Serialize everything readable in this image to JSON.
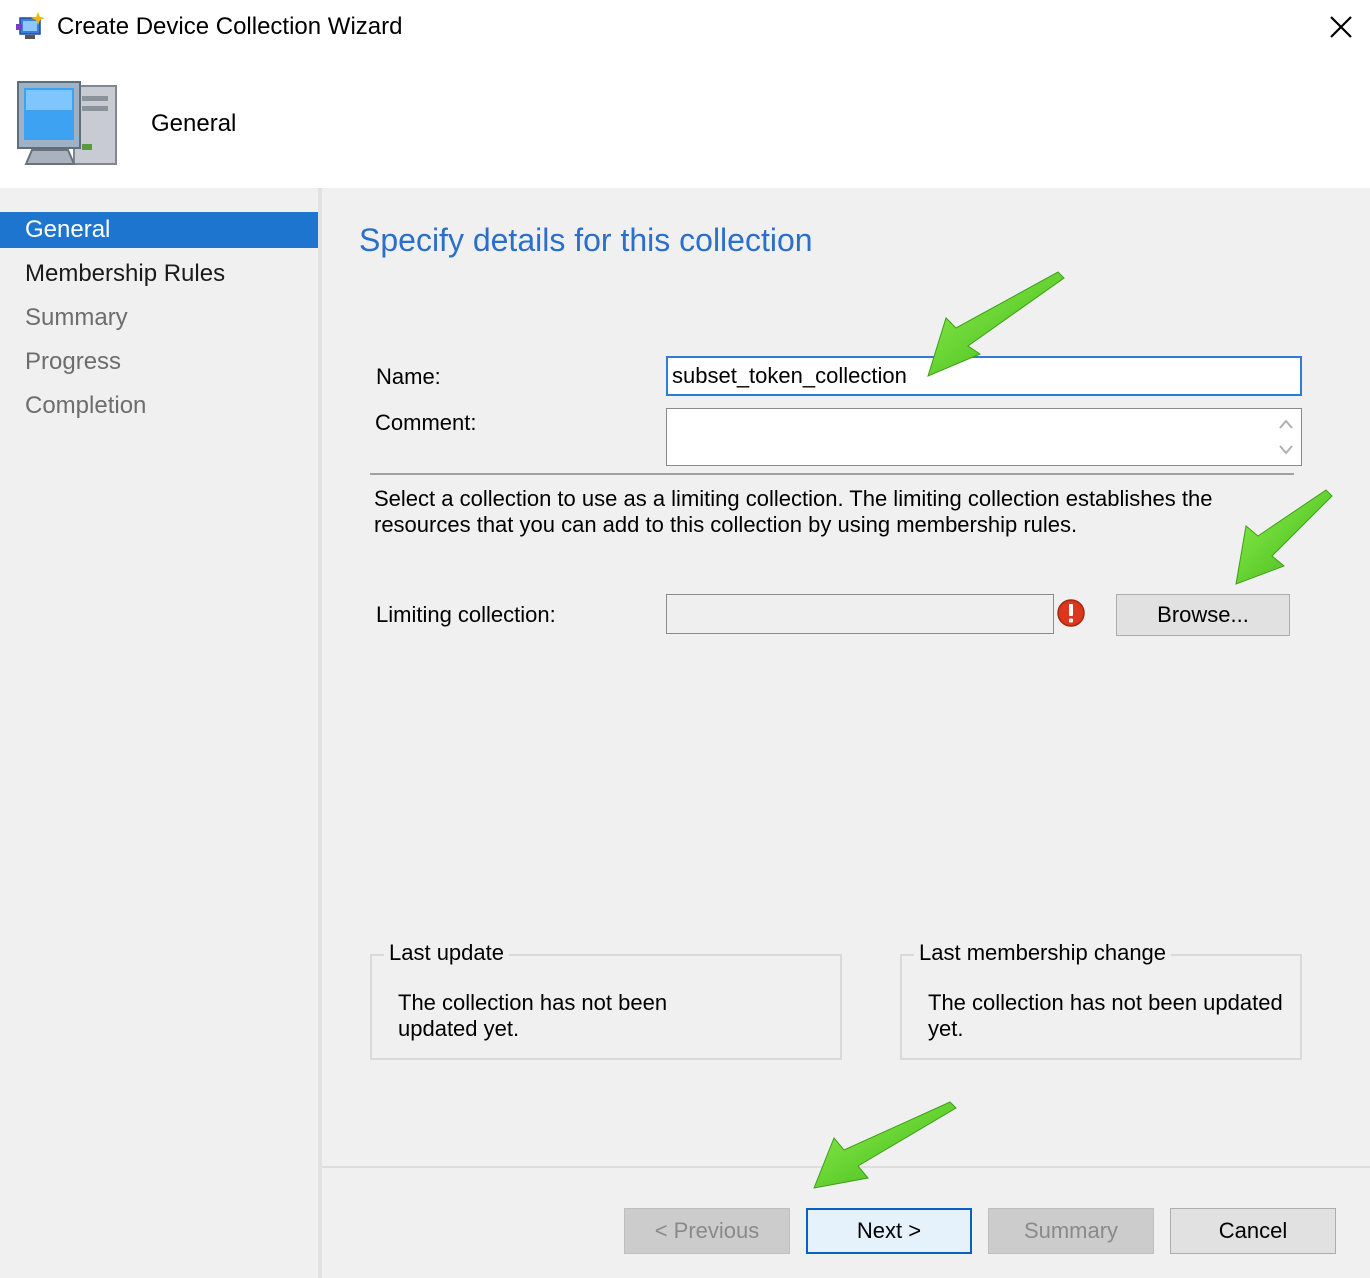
{
  "window": {
    "title": "Create Device Collection Wizard"
  },
  "header": {
    "title": "General"
  },
  "sidebar": {
    "items": [
      {
        "label": "General",
        "state": "active"
      },
      {
        "label": "Membership Rules",
        "state": "next"
      },
      {
        "label": "Summary",
        "state": "pending"
      },
      {
        "label": "Progress",
        "state": "pending"
      },
      {
        "label": "Completion",
        "state": "pending"
      }
    ]
  },
  "page": {
    "title": "Specify details for this collection",
    "name_label": "Name:",
    "name_value": "subset_token_collection",
    "comment_label": "Comment:",
    "comment_value": "",
    "description": "Select a collection to use as a limiting collection. The limiting collection establishes the resources that you can add to this collection by using membership rules.",
    "limiting_label": "Limiting collection:",
    "limiting_value": "",
    "browse_label": "Browse...",
    "last_update": {
      "legend": "Last update",
      "text": "The collection has not been updated yet."
    },
    "last_membership": {
      "legend": "Last membership change",
      "text": "The collection has not been updated yet."
    }
  },
  "footer": {
    "previous_label": "< Previous",
    "next_label": "Next >",
    "summary_label": "Summary",
    "cancel_label": "Cancel"
  },
  "colors": {
    "accent": "#1e75cf",
    "title_blue": "#2a6fc9",
    "error_red": "#d9381e",
    "annotation_green": "#5fd12a"
  },
  "icons": {
    "title": "wizard-icon",
    "header": "computer-icon",
    "close": "close-icon",
    "error": "error-icon"
  }
}
